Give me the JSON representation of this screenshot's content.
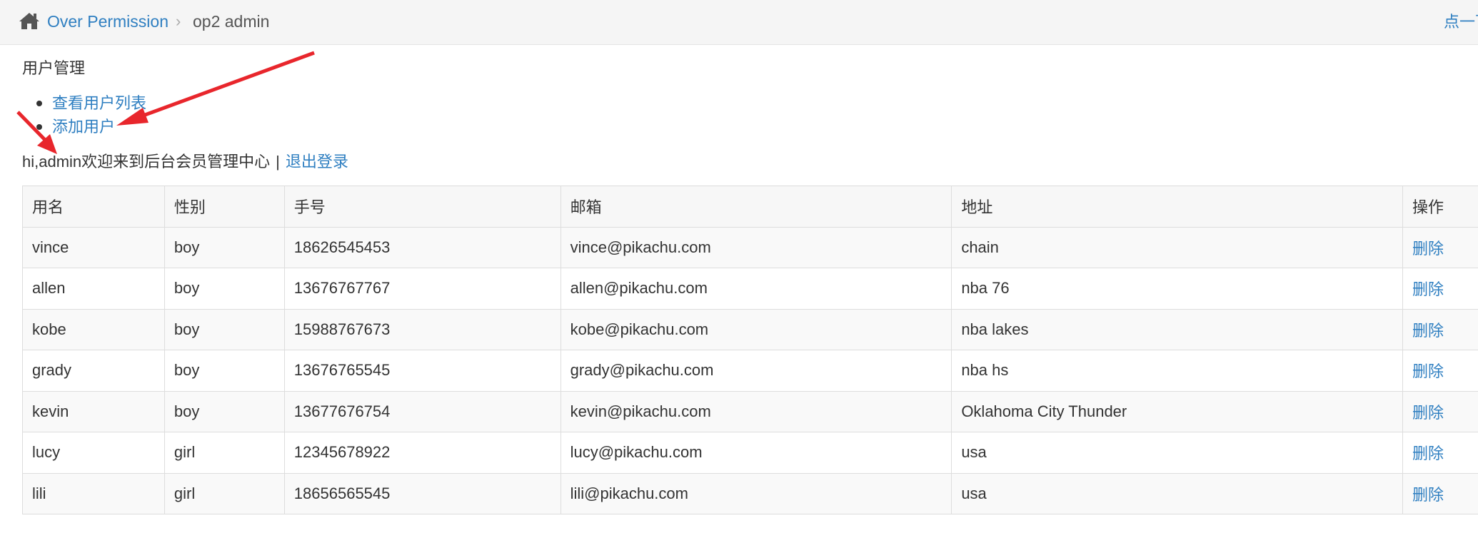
{
  "breadcrumb": {
    "link_label": "Over Permission",
    "separator": "›",
    "current": "op2 admin",
    "right_link": "点一下提示"
  },
  "menu": {
    "title": "用户管理",
    "items": [
      {
        "label": "查看用户列表"
      },
      {
        "label": "添加用户"
      }
    ]
  },
  "welcome": {
    "text": "hi,admin欢迎来到后台会员管理中心",
    "separator": "|",
    "logout_label": "退出登录"
  },
  "table": {
    "headers": [
      "用名",
      "性别",
      "手号",
      "邮箱",
      "地址",
      "操作"
    ],
    "rows": [
      {
        "name": "vince",
        "gender": "boy",
        "phone": "18626545453",
        "email": "vince@pikachu.com",
        "address": "chain",
        "action": "删除"
      },
      {
        "name": "allen",
        "gender": "boy",
        "phone": "13676767767",
        "email": "allen@pikachu.com",
        "address": "nba 76",
        "action": "删除"
      },
      {
        "name": "kobe",
        "gender": "boy",
        "phone": "15988767673",
        "email": "kobe@pikachu.com",
        "address": "nba lakes",
        "action": "删除"
      },
      {
        "name": "grady",
        "gender": "boy",
        "phone": "13676765545",
        "email": "grady@pikachu.com",
        "address": "nba hs",
        "action": "删除"
      },
      {
        "name": "kevin",
        "gender": "boy",
        "phone": "13677676754",
        "email": "kevin@pikachu.com",
        "address": "Oklahoma City Thunder",
        "action": "删除"
      },
      {
        "name": "lucy",
        "gender": "girl",
        "phone": "12345678922",
        "email": "lucy@pikachu.com",
        "address": "usa",
        "action": "删除"
      },
      {
        "name": "lili",
        "gender": "girl",
        "phone": "18656565545",
        "email": "lili@pikachu.com",
        "address": "usa",
        "action": "删除"
      }
    ]
  },
  "annotation": {
    "arrow_color": "#e8262c"
  },
  "colors": {
    "link": "#2f7fc1",
    "text": "#333333",
    "breadcrumb_bg": "#f5f5f5"
  }
}
